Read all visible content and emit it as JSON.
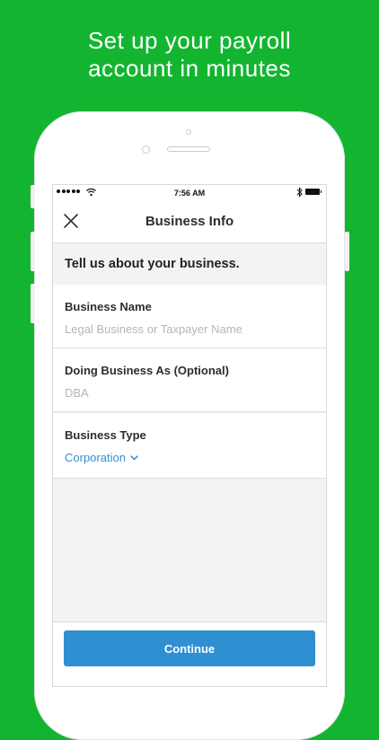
{
  "headline": {
    "line1": "Set up your payroll",
    "line2": "account in minutes"
  },
  "status_bar": {
    "time": "7:56 AM",
    "signal_icon": "signal-dots-icon",
    "wifi_icon": "wifi-icon",
    "bluetooth_icon": "bluetooth-icon",
    "battery_icon": "battery-icon"
  },
  "nav": {
    "title": "Business Info",
    "close_icon": "close-icon"
  },
  "section": {
    "title": "Tell us about your business."
  },
  "fields": {
    "business_name": {
      "label": "Business Name",
      "placeholder": "Legal Business or Taxpayer Name",
      "value": ""
    },
    "dba": {
      "label": "Doing Business As (Optional)",
      "placeholder": "DBA",
      "value": ""
    },
    "business_type": {
      "label": "Business Type",
      "selected": "Corporation"
    }
  },
  "actions": {
    "continue_label": "Continue"
  },
  "colors": {
    "background": "#13b530",
    "accent": "#2f8fd1"
  }
}
